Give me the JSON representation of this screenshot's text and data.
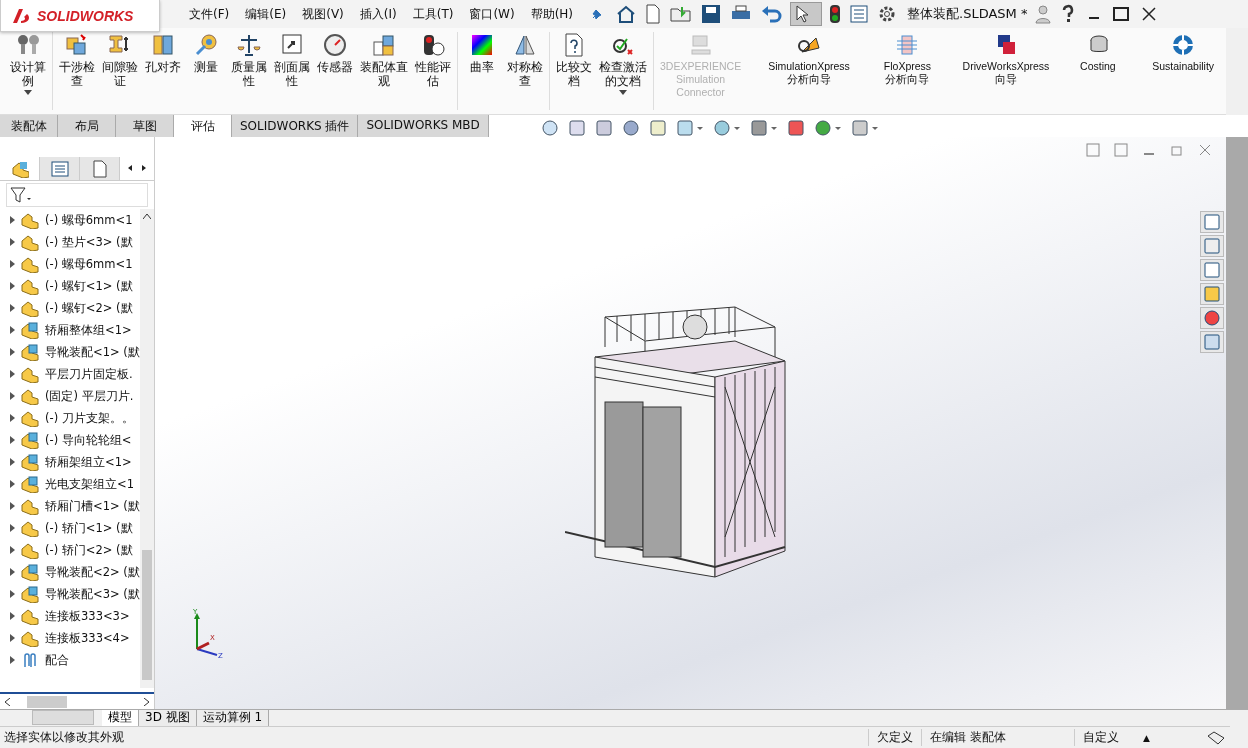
{
  "window": {
    "logo": "SOLIDWORKS",
    "title": "整体装配.SLDASM *"
  },
  "menu": [
    "文件(F)",
    "编辑(E)",
    "视图(V)",
    "插入(I)",
    "工具(T)",
    "窗口(W)",
    "帮助(H)"
  ],
  "ribbon": {
    "groups": [
      [
        {
          "label": "设计算例",
          "kind": "study",
          "dropdown": true,
          "disabled": false
        }
      ],
      [
        {
          "label": "干涉检查",
          "kind": "interfere",
          "dropdown": false,
          "disabled": false
        },
        {
          "label": "间隙验证",
          "kind": "clearance",
          "dropdown": false,
          "disabled": false
        },
        {
          "label": "孔对齐",
          "kind": "hole",
          "dropdown": false,
          "disabled": false
        },
        {
          "label": "测量",
          "kind": "measure",
          "dropdown": false,
          "disabled": false
        },
        {
          "label": "质量属性",
          "kind": "mass",
          "dropdown": false,
          "disabled": false
        },
        {
          "label": "剖面属性",
          "kind": "section",
          "dropdown": false,
          "disabled": false
        },
        {
          "label": "传感器",
          "kind": "sensor",
          "dropdown": false,
          "disabled": false
        },
        {
          "label": "装配体直观",
          "kind": "visual",
          "dropdown": false,
          "disabled": false
        },
        {
          "label": "性能评估",
          "kind": "perf",
          "dropdown": false,
          "disabled": false
        }
      ],
      [
        {
          "label": "曲率",
          "kind": "curv",
          "dropdown": false,
          "disabled": false
        },
        {
          "label": "对称检查",
          "kind": "sym",
          "dropdown": false,
          "disabled": false
        }
      ],
      [
        {
          "label": "比较文档",
          "kind": "compare",
          "dropdown": false,
          "disabled": false
        },
        {
          "label": "检查激活的文档",
          "kind": "check",
          "dropdown": true,
          "disabled": false
        }
      ],
      [
        {
          "label": "3DEXPERIENCE Simulation Connector",
          "kind": "connector",
          "dropdown": false,
          "disabled": true
        },
        {
          "label": "SimulationXpress 分析向导",
          "kind": "simx",
          "dropdown": false,
          "disabled": false
        },
        {
          "label": "FloXpress 分析向导",
          "kind": "flox",
          "dropdown": false,
          "disabled": false
        },
        {
          "label": "DriveWorksXpress 向导",
          "kind": "drive",
          "dropdown": false,
          "disabled": false
        },
        {
          "label": "Costing",
          "kind": "cost",
          "dropdown": false,
          "disabled": false
        },
        {
          "label": "Sustainability",
          "kind": "sust",
          "dropdown": false,
          "disabled": false
        }
      ]
    ]
  },
  "command_tabs": [
    {
      "label": "装配体",
      "selected": false
    },
    {
      "label": "布局",
      "selected": false
    },
    {
      "label": "草图",
      "selected": false
    },
    {
      "label": "评估",
      "selected": true
    },
    {
      "label": "SOLIDWORKS 插件",
      "selected": false
    },
    {
      "label": "SOLIDWORKS MBD",
      "selected": false
    }
  ],
  "feature_tree": [
    {
      "kind": "part",
      "label": "(-) 螺母6mm<1"
    },
    {
      "kind": "part",
      "label": "(-) 垫片<3> (默"
    },
    {
      "kind": "part",
      "label": "(-) 螺母6mm<1"
    },
    {
      "kind": "part",
      "label": "(-) 螺钉<1> (默"
    },
    {
      "kind": "part",
      "label": "(-) 螺钉<2> (默"
    },
    {
      "kind": "assembly",
      "label": "轿厢整体组<1>"
    },
    {
      "kind": "assembly",
      "label": "导靴装配<1> (默"
    },
    {
      "kind": "part",
      "label": "平层刀片固定板."
    },
    {
      "kind": "part",
      "label": "(固定) 平层刀片."
    },
    {
      "kind": "part",
      "label": "(-) 刀片支架。。"
    },
    {
      "kind": "assembly",
      "label": "(-) 导向轮轮组<"
    },
    {
      "kind": "assembly",
      "label": "轿厢架组立<1>"
    },
    {
      "kind": "assembly",
      "label": "光电支架组立<1"
    },
    {
      "kind": "part",
      "label": "轿厢门槽<1> (默"
    },
    {
      "kind": "part",
      "label": "(-) 轿门<1> (默"
    },
    {
      "kind": "part",
      "label": "(-) 轿门<2> (默"
    },
    {
      "kind": "assembly",
      "label": "导靴装配<2> (默"
    },
    {
      "kind": "assembly",
      "label": "导靴装配<3> (默"
    },
    {
      "kind": "part",
      "label": "连接板333<3>"
    },
    {
      "kind": "part",
      "label": "连接板333<4>"
    },
    {
      "kind": "mates",
      "label": "配合"
    }
  ],
  "model_tabs": [
    {
      "label": "模型",
      "selected": true
    },
    {
      "label": "3D 视图",
      "selected": false
    },
    {
      "label": "运动算例 1",
      "selected": false
    }
  ],
  "triad": {
    "x": "X",
    "y": "Y",
    "z": "Z"
  },
  "status_bar": {
    "message": "选择实体以修改其外观",
    "state": "欠定义",
    "mode": "在编辑 装配体",
    "units": "自定义",
    "units_arrow": "▲"
  }
}
